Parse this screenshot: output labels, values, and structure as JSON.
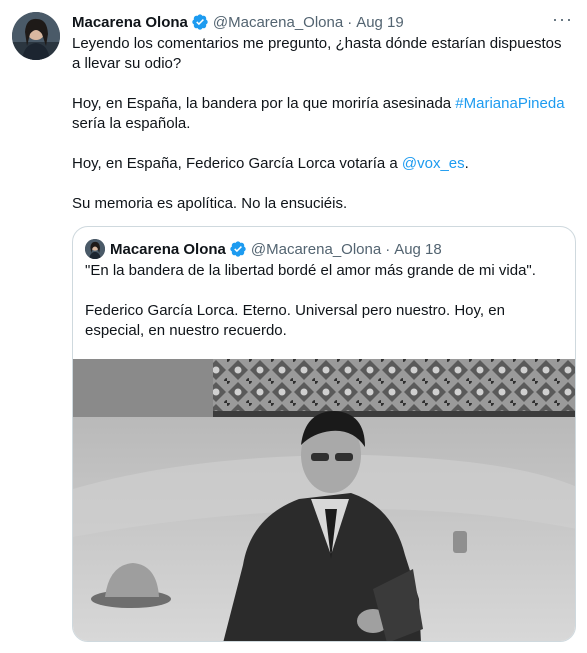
{
  "tweet": {
    "author_name": "Macarena Olona",
    "author_handle": "@Macarena_Olona",
    "separator": "·",
    "date": "Aug 19",
    "more_icon": "more-horizontal-icon",
    "text": {
      "p1": "Leyendo los comentarios me pregunto, ¿hasta dónde estarían dispuestos a llevar su odio?",
      "p2_prefix": "Hoy, en España, la bandera por la que moriría asesinada ",
      "p2_hashtag": "#MarianaPineda",
      "p2_suffix": " sería la española.",
      "p3_prefix": "Hoy, en España, Federico García Lorca votaría a ",
      "p3_mention": "@vox_es",
      "p3_suffix": ".",
      "p4": "Su memoria es apolítica. No la ensuciéis."
    }
  },
  "quoted": {
    "author_name": "Macarena Olona",
    "author_handle": "@Macarena_Olona",
    "separator": "·",
    "date": "Aug 18",
    "p1": "\"En la bandera de la libertad bordé el amor más grande de mi vida\".",
    "p2": "Federico García Lorca. Eterno. Universal pero nuestro. Hoy, en especial, en nuestro recuerdo."
  },
  "colors": {
    "link": "#1d9bf0",
    "verified": "#1d9bf0",
    "muted": "#536471",
    "border": "#cfd9de"
  }
}
